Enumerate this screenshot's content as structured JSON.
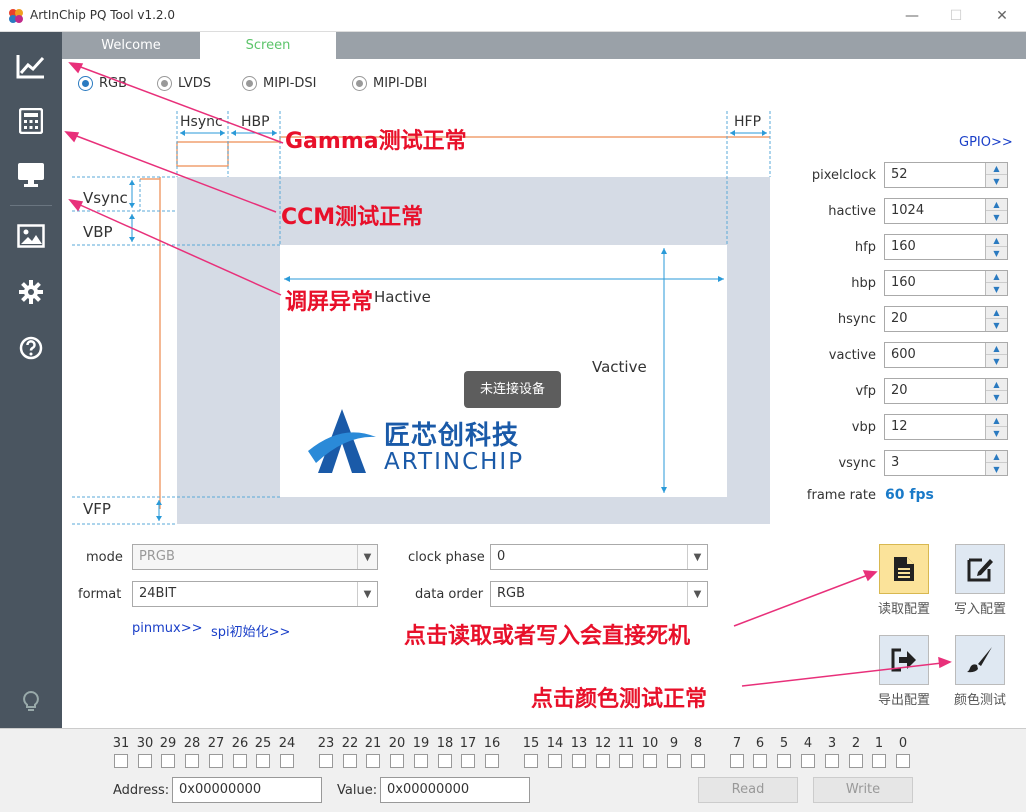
{
  "app": {
    "title": "ArtInChip PQ Tool v1.2.0"
  },
  "tabs": [
    {
      "label": "Welcome"
    },
    {
      "label": "Screen"
    }
  ],
  "interfaces": [
    "RGB",
    "LVDS",
    "MIPI-DSI",
    "MIPI-DBI"
  ],
  "selected_interface": "RGB",
  "diagram": {
    "hsync": "Hsync",
    "hbp": "HBP",
    "hfp": "HFP",
    "vsync": "Vsync",
    "vbp": "VBP",
    "vfp": "VFP",
    "hactive": "Hactive",
    "vactive": "Vactive",
    "status": "未连接设备",
    "logo_cn": "匠芯创科技",
    "logo_en": "ARTINCHIP"
  },
  "gpio_link": "GPIO>>",
  "params": [
    {
      "label": "pixelclock",
      "value": "52"
    },
    {
      "label": "hactive",
      "value": "1024"
    },
    {
      "label": "hfp",
      "value": "160"
    },
    {
      "label": "hbp",
      "value": "160"
    },
    {
      "label": "hsync",
      "value": "20"
    },
    {
      "label": "vactive",
      "value": "600"
    },
    {
      "label": "vfp",
      "value": "20"
    },
    {
      "label": "vbp",
      "value": "12"
    },
    {
      "label": "vsync",
      "value": "3"
    }
  ],
  "frame_rate": {
    "label": "frame rate",
    "value": "60 fps"
  },
  "mode": {
    "label": "mode",
    "value": "PRGB"
  },
  "format": {
    "label": "format",
    "value": "24BIT"
  },
  "clock_phase": {
    "label": "clock phase",
    "value": "0"
  },
  "data_order": {
    "label": "data order",
    "value": "RGB"
  },
  "links": {
    "pinmux": "pinmux>>",
    "spi": "spi初始化>>"
  },
  "actions": [
    {
      "label": "读取配置"
    },
    {
      "label": "写入配置"
    },
    {
      "label": "导出配置"
    },
    {
      "label": "颜色测试"
    }
  ],
  "bits_group1": [
    "31",
    "30",
    "29",
    "28",
    "27",
    "26",
    "25",
    "24"
  ],
  "bits_group2": [
    "23",
    "22",
    "21",
    "20",
    "19",
    "18",
    "17",
    "16"
  ],
  "bits_group3": [
    "15",
    "14",
    "13",
    "12",
    "11",
    "10",
    "9",
    "8"
  ],
  "bits_group4": [
    "7",
    "6",
    "5",
    "4",
    "3",
    "2",
    "1",
    "0"
  ],
  "register": {
    "address_label": "Address:",
    "address_value": "0x00000000",
    "value_label": "Value:",
    "value_value": "0x00000000",
    "read_label": "Read",
    "write_label": "Write"
  },
  "annotations": {
    "gamma": "Gamma测试正常",
    "ccm": "CCM测试正常",
    "screen": "调屏异常",
    "readwrite": "点击读取或者写入会直接死机",
    "color": "点击颜色测试正常"
  },
  "colors": {
    "accent": "#2a7ac0",
    "annotation": "#e8102a",
    "sidebar": "#4a5560"
  }
}
